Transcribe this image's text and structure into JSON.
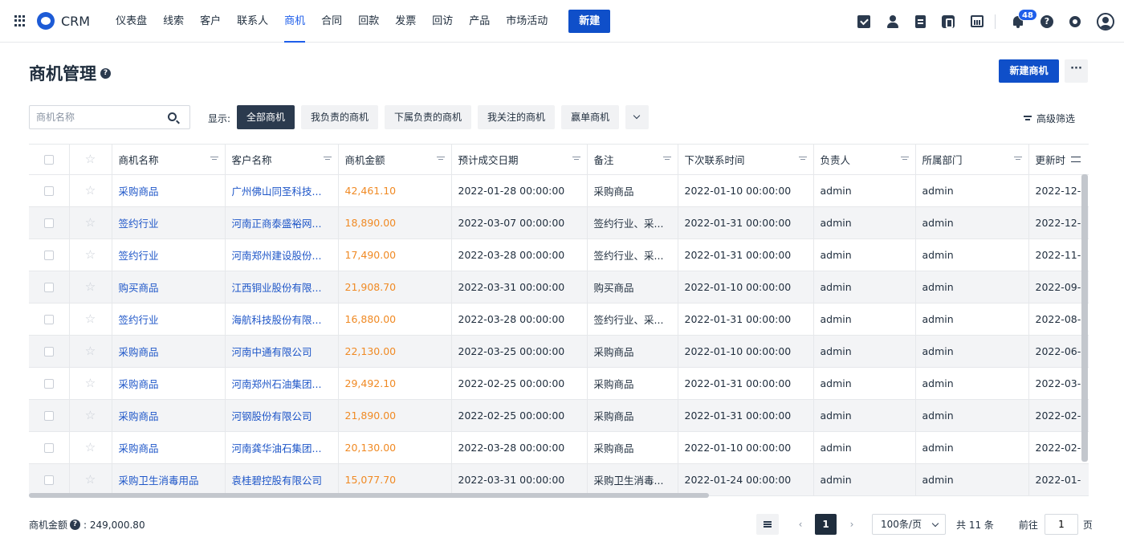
{
  "app": {
    "name": "CRM",
    "new_label": "新建"
  },
  "nav": [
    "仪表盘",
    "线索",
    "客户",
    "联系人",
    "商机",
    "合同",
    "回款",
    "发票",
    "回访",
    "产品",
    "市场活动"
  ],
  "notifications": {
    "count": "48"
  },
  "page": {
    "title": "商机管理",
    "create_label": "新建商机",
    "more_label": "···"
  },
  "filter": {
    "search_placeholder": "商机名称",
    "show_label": "显示:",
    "tabs": [
      "全部商机",
      "我负责的商机",
      "下属负责的商机",
      "我关注的商机",
      "赢单商机"
    ],
    "advanced_label": "高级筛选"
  },
  "table": {
    "columns": [
      "商机名称",
      "客户名称",
      "商机金额",
      "预计成交日期",
      "备注",
      "下次联系时间",
      "负责人",
      "所属部门",
      "更新时"
    ],
    "rows": [
      [
        "采购商品",
        "广州佛山同圣科技...",
        "42,461.10",
        "2022-01-28 00:00:00",
        "采购商品",
        "2022-01-10 00:00:00",
        "admin",
        "admin",
        "2022-12-"
      ],
      [
        "签约行业",
        "河南正商泰盛裕网...",
        "18,890.00",
        "2022-03-07 00:00:00",
        "签约行业、采...",
        "2022-01-31 00:00:00",
        "admin",
        "admin",
        "2022-12-"
      ],
      [
        "签约行业",
        "河南郑州建设股份...",
        "17,490.00",
        "2022-03-28 00:00:00",
        "签约行业、采...",
        "2022-01-31 00:00:00",
        "admin",
        "admin",
        "2022-11-("
      ],
      [
        "购买商品",
        "江西铜业股份有限...",
        "21,908.70",
        "2022-03-31 00:00:00",
        "购买商品",
        "2022-01-10 00:00:00",
        "admin",
        "admin",
        "2022-09-"
      ],
      [
        "签约行业",
        "海航科技股份有限...",
        "16,880.00",
        "2022-03-28 00:00:00",
        "签约行业、采...",
        "2022-01-31 00:00:00",
        "admin",
        "admin",
        "2022-08-"
      ],
      [
        "采购商品",
        "河南中通有限公司",
        "22,130.00",
        "2022-03-25 00:00:00",
        "采购商品",
        "2022-01-10 00:00:00",
        "admin",
        "admin",
        "2022-06-"
      ],
      [
        "采购商品",
        "河南郑州石油集团...",
        "29,492.10",
        "2022-02-25 00:00:00",
        "采购商品",
        "2022-01-31 00:00:00",
        "admin",
        "admin",
        "2022-03-"
      ],
      [
        "采购商品",
        "河钢股份有限公司",
        "21,890.00",
        "2022-02-25 00:00:00",
        "采购商品",
        "2022-01-31 00:00:00",
        "admin",
        "admin",
        "2022-02-"
      ],
      [
        "采购商品",
        "河南龚华油石集团...",
        "20,130.00",
        "2022-03-28 00:00:00",
        "采购商品",
        "2022-01-10 00:00:00",
        "admin",
        "admin",
        "2022-02-"
      ],
      [
        "采购卫生消毒用品",
        "袁桂碧控股有限公司",
        "15,077.70",
        "2022-03-31 00:00:00",
        "采购卫生消毒...",
        "2022-01-24 00:00:00",
        "admin",
        "admin",
        "2022-01-"
      ]
    ]
  },
  "footer": {
    "total_label": "商机金额",
    "total_value": ": 249,000.80",
    "current_page": "1",
    "page_size": "100条/页",
    "count_text": "共 11 条",
    "goto_label": "前往",
    "goto_value": "1",
    "goto_suffix": "页",
    "prev": "‹",
    "next": "›"
  },
  "colors": {
    "primary": "#0f4fc9",
    "link": "#1e56c8",
    "amount": "#f08a24",
    "dark": "#2b3a4e"
  }
}
